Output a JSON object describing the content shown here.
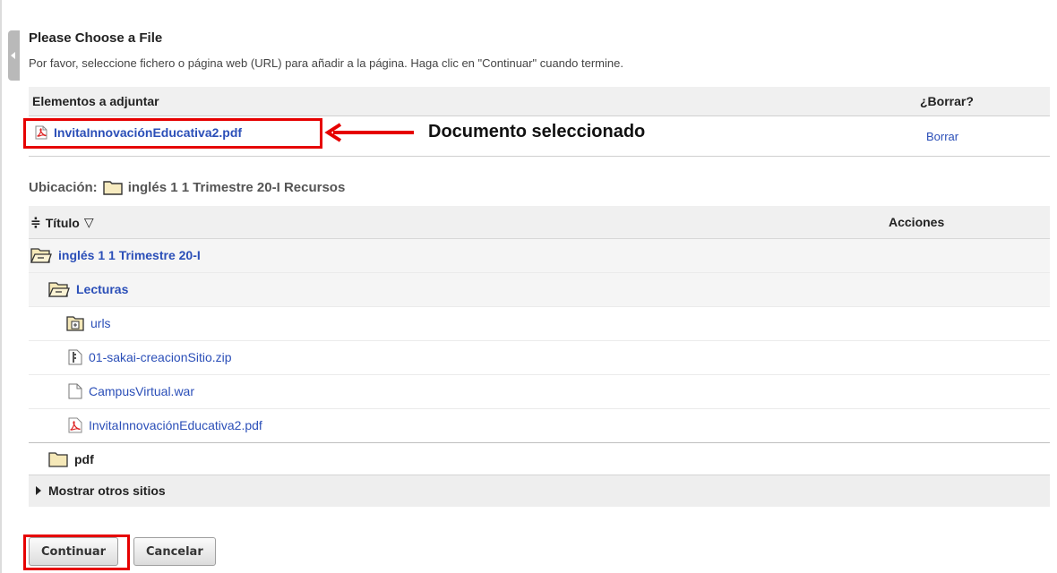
{
  "page": {
    "title": "Please Choose a File",
    "instructions": "Por favor, seleccione fichero o página web (URL) para añadir a la página. Haga clic en \"Continuar\" cuando termine."
  },
  "attachments": {
    "col_items": "Elementos a adjuntar",
    "col_delete": "¿Borrar?",
    "item": {
      "name": "InvitaInnovaciónEducativa2.pdf",
      "icon": "pdf-icon",
      "delete_label": "Borrar"
    },
    "annotation": "Documento seleccionado"
  },
  "location": {
    "label": "Ubicación:",
    "path": "inglés 1 1 Trimestre 20-I Recursos"
  },
  "resources": {
    "col_title": "Título",
    "col_actions": "Acciones",
    "rows": [
      {
        "name": "inglés 1 1 Trimestre 20-I",
        "icon": "folder-open-icon"
      },
      {
        "name": "Lecturas",
        "icon": "folder-open-icon"
      },
      {
        "name": "urls",
        "icon": "folder-plus-icon"
      },
      {
        "name": "01-sakai-creacionSitio.zip",
        "icon": "zip-file-icon"
      },
      {
        "name": "CampusVirtual.war",
        "icon": "file-icon"
      },
      {
        "name": "InvitaInnovaciónEducativa2.pdf",
        "icon": "pdf-icon"
      },
      {
        "name": "pdf",
        "icon": "folder-closed-icon"
      }
    ]
  },
  "other_sites": "Mostrar otros sitios",
  "buttons": {
    "continue": "Continuar",
    "cancel": "Cancelar"
  },
  "colors": {
    "link": "#2b4fb8",
    "highlight": "#e60000",
    "header_bg": "#f0f0f0"
  }
}
